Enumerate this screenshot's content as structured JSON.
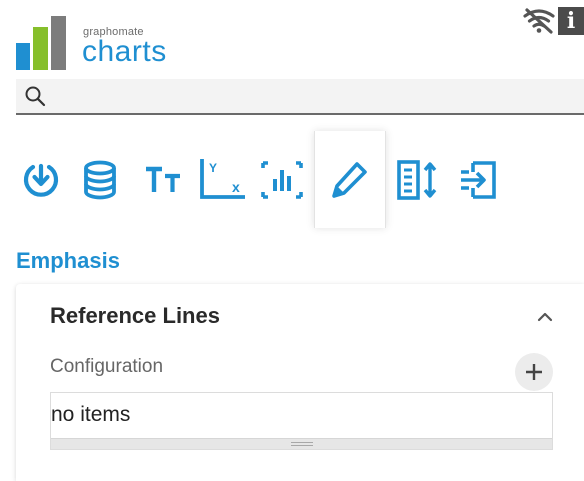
{
  "brand": {
    "small": "graphomate",
    "name": "charts",
    "colors": {
      "blue": "#1f8fd1",
      "green": "#86bf2b",
      "grey": "#7c7c7c"
    }
  },
  "header_icons": [
    "wifi-off-icon",
    "info-icon"
  ],
  "info_label": "i",
  "search": {
    "value": "",
    "placeholder": ""
  },
  "tabs": [
    {
      "icon": "download-icon",
      "active": false
    },
    {
      "icon": "database-icon",
      "active": false
    },
    {
      "icon": "text-format-icon",
      "active": false
    },
    {
      "icon": "axis-xy-icon",
      "active": false
    },
    {
      "icon": "bar-chart-frame-icon",
      "active": false
    },
    {
      "icon": "pencil-icon",
      "active": true
    },
    {
      "icon": "layout-height-icon",
      "active": false
    },
    {
      "icon": "export-icon",
      "active": false
    }
  ],
  "axis_icon_letters": {
    "y": "Y",
    "x": "x"
  },
  "section": {
    "title": "Emphasis"
  },
  "panel": {
    "title": "Reference Lines",
    "config_label": "Configuration",
    "list_empty_text": "no items"
  }
}
